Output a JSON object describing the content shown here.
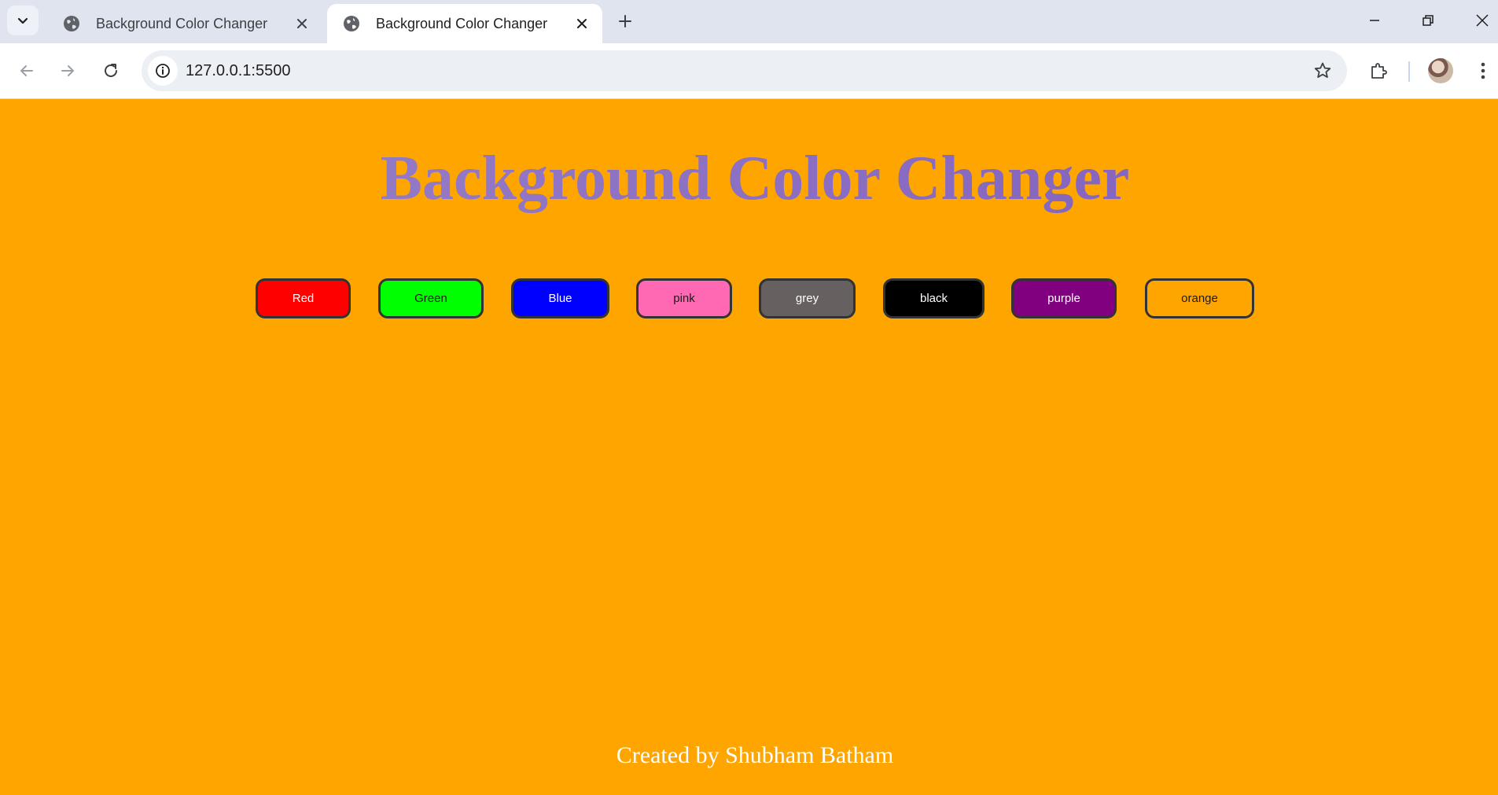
{
  "browser": {
    "tabs": [
      {
        "title": "Background Color Changer",
        "active": false
      },
      {
        "title": "Background Color Changer",
        "active": true
      }
    ],
    "url": "127.0.0.1:5500"
  },
  "page": {
    "background_color": "#ffa500",
    "title": "Background Color Changer",
    "title_color": "#8a6cc4",
    "buttons": [
      {
        "label": "Red",
        "color": "#ff0000",
        "text_color": "#ffffff"
      },
      {
        "label": "Green",
        "color": "#00ff00",
        "text_color": "#1a1a1a"
      },
      {
        "label": "Blue",
        "color": "#0000ff",
        "text_color": "#ffffff"
      },
      {
        "label": "pink",
        "color": "#ff69b4",
        "text_color": "#1a1a1a"
      },
      {
        "label": "grey",
        "color": "#666060",
        "text_color": "#ffffff"
      },
      {
        "label": "black",
        "color": "#000000",
        "text_color": "#ffffff"
      },
      {
        "label": "purple",
        "color": "#800080",
        "text_color": "#ffffff"
      },
      {
        "label": "orange",
        "color": "#ffa500",
        "text_color": "#1a1a1a"
      }
    ],
    "footer": "Created by Shubham Batham"
  }
}
